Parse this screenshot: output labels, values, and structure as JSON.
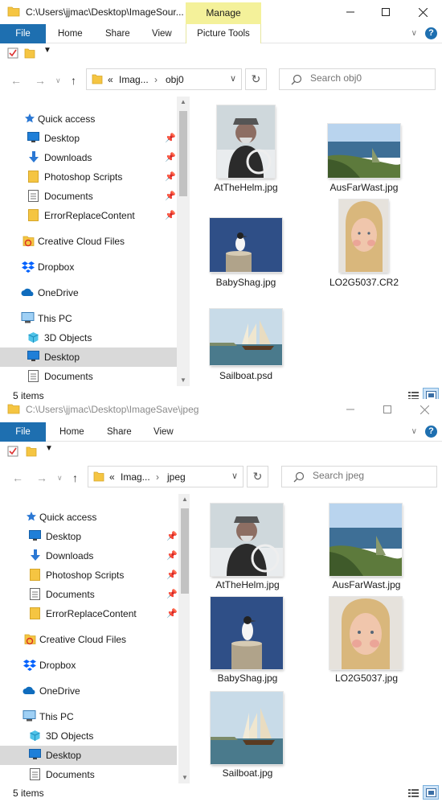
{
  "window_top": {
    "title": "C:\\Users\\jjmac\\Desktop\\ImageSour...",
    "contextual_tab_header": "Manage",
    "tabs": [
      "File",
      "Home",
      "Share",
      "View",
      "Picture Tools"
    ],
    "address": {
      "crumb_prefix": "«",
      "crumbs": [
        "Imag...",
        "obj0"
      ]
    },
    "search_placeholder": "Search obj0",
    "nav": {
      "quick_access": "Quick access",
      "pinned": [
        "Desktop",
        "Downloads",
        "Photoshop Scripts",
        "Documents",
        "ErrorReplaceContent"
      ],
      "creative_cloud": "Creative Cloud Files",
      "dropbox": "Dropbox",
      "onedrive": "OneDrive",
      "this_pc": "This PC",
      "pc_items": [
        "3D Objects",
        "Desktop",
        "Documents"
      ],
      "selected": "Desktop"
    },
    "files": [
      "AtTheHelm.jpg",
      "AusFarWast.jpg",
      "BabyShag.jpg",
      "LO2G5037.CR2",
      "Sailboat.psd"
    ],
    "status": "5 items"
  },
  "window_bottom": {
    "title": "C:\\Users\\jjmac\\Desktop\\ImageSave\\jpeg",
    "tabs": [
      "File",
      "Home",
      "Share",
      "View"
    ],
    "address": {
      "crumb_prefix": "«",
      "crumbs": [
        "Imag...",
        "jpeg"
      ]
    },
    "search_placeholder": "Search jpeg",
    "nav": {
      "quick_access": "Quick access",
      "pinned": [
        "Desktop",
        "Downloads",
        "Photoshop Scripts",
        "Documents",
        "ErrorReplaceContent"
      ],
      "creative_cloud": "Creative Cloud Files",
      "dropbox": "Dropbox",
      "onedrive": "OneDrive",
      "this_pc": "This PC",
      "pc_items": [
        "3D Objects",
        "Desktop",
        "Documents"
      ],
      "selected": "Desktop"
    },
    "files": [
      "AtTheHelm.jpg",
      "AusFarWast.jpg",
      "BabyShag.jpg",
      "LO2G5037.jpg",
      "Sailboat.jpg"
    ],
    "status": "5 items"
  },
  "colors": {
    "file_tab": "#1e6fb0",
    "manage_highlight": "#f4f19a",
    "selection": "#d9d9d9",
    "folder": "#f5c542"
  }
}
